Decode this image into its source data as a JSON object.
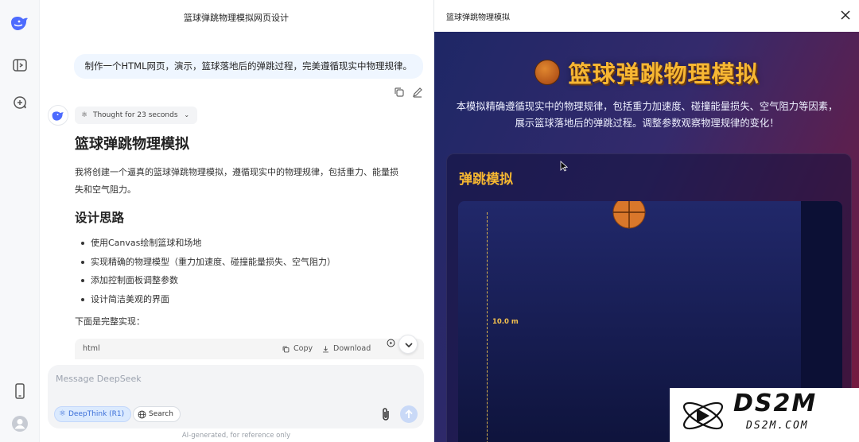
{
  "chat": {
    "title": "篮球弹跳物理模拟网页设计",
    "user_message": "制作一个HTML网页，演示，篮球落地后的弹跳过程，完美遵循现实中物理规律。",
    "thought_label": "Thought for 23 seconds",
    "answer": {
      "heading": "篮球弹跳物理模拟",
      "intro": "我将创建一个逼真的篮球弹跳物理模拟，遵循现实中的物理规律，包括重力、能量损失和空气阻力。",
      "design_heading": "设计思路",
      "design_items": [
        "使用Canvas绘制篮球和场地",
        "实现精确的物理模型（重力加速度、碰撞能量损失、空气阻力）",
        "添加控制面板调整参数",
        "设计简洁美观的界面"
      ],
      "outro": "下面是完整实现："
    },
    "code_block": {
      "lang": "html",
      "copy_label": "Copy",
      "download_label": "Download"
    },
    "composer": {
      "placeholder": "Message DeepSeek",
      "deepthink_label": "DeepThink (R1)",
      "search_label": "Search"
    },
    "disclaimer": "AI-generated, for reference only"
  },
  "preview": {
    "header_title": "篮球弹跳物理模拟",
    "page_title": "篮球弹跳物理模拟",
    "description": "本模拟精确遵循现实中的物理规律，包括重力加速度、碰撞能量损失、空气阻力等因素，展示篮球落地后的弹跳过程。调整参数观察物理规律的变化！",
    "panel_title": "弹跳模拟",
    "height_marker": "10.0 m"
  },
  "watermark": {
    "text": "DS2M",
    "url": "DS2M.COM"
  },
  "colors": {
    "accent_blue": "#3b6fd8",
    "preview_title": "#f7b733",
    "ball": "#d9772b"
  },
  "icons": [
    "deepseek-whale-icon",
    "sidebar-toggle-icon",
    "new-chat-icon",
    "phone-icon",
    "user-avatar-icon",
    "copy-icon",
    "edit-icon",
    "atom-icon",
    "globe-icon",
    "paperclip-icon",
    "send-arrow-icon",
    "close-icon",
    "chevron-down-icon",
    "download-icon",
    "run-icon"
  ]
}
